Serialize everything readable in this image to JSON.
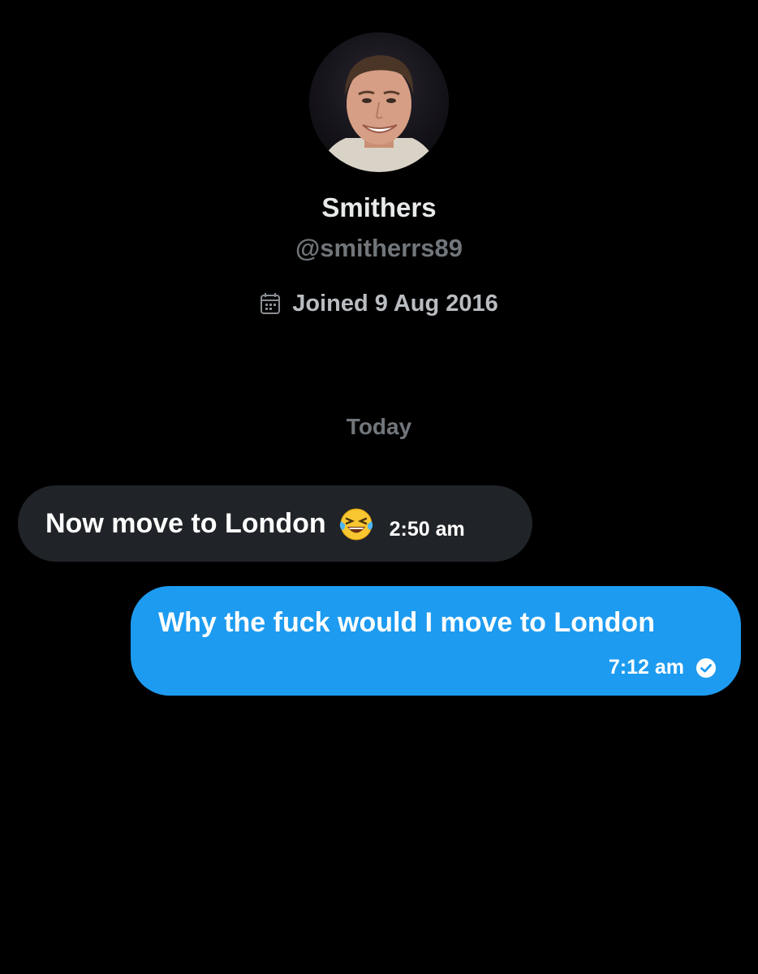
{
  "profile": {
    "name": "Smithers",
    "handle": "@smitherrs89",
    "joined": "Joined 9 Aug 2016",
    "avatar_icon": "profile-photo"
  },
  "conversation": {
    "day_divider": "Today",
    "messages": [
      {
        "direction": "incoming",
        "text": "Now move to London",
        "emoji": "face-with-tears-of-joy",
        "time": "2:50 am"
      },
      {
        "direction": "outgoing",
        "text": "Why the fuck would I move to London",
        "time": "7:12 am",
        "status_icon": "read-check-icon"
      }
    ]
  },
  "colors": {
    "background": "#000000",
    "incoming_bubble": "#202327",
    "outgoing_bubble": "#1d9bf0",
    "muted_text": "#71767b"
  }
}
